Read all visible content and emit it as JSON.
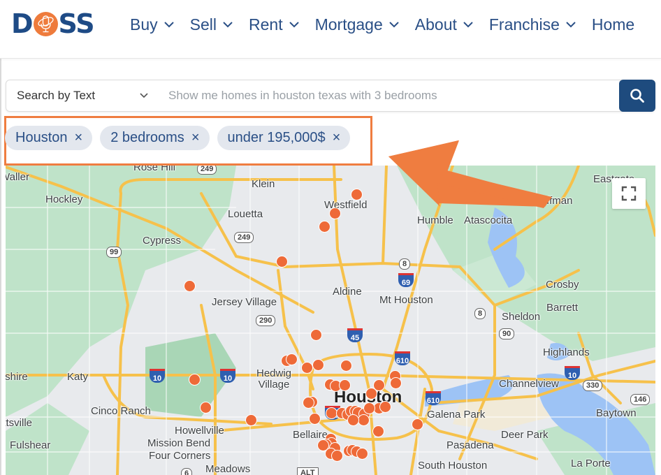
{
  "brand": {
    "logo_text_left": "D",
    "logo_text_right": "SS",
    "brand_color": "#1e4b86",
    "accent_color": "#ee7b3c"
  },
  "nav": {
    "items": [
      {
        "label": "Buy",
        "icon": "chevron-down-icon"
      },
      {
        "label": "Sell",
        "icon": "chevron-down-icon"
      },
      {
        "label": "Rent",
        "icon": "chevron-down-icon"
      },
      {
        "label": "Mortgage",
        "icon": "chevron-down-icon"
      },
      {
        "label": "About",
        "icon": "chevron-down-icon"
      },
      {
        "label": "Franchise",
        "icon": "chevron-down-icon"
      },
      {
        "label": "Home"
      }
    ]
  },
  "search": {
    "mode_label": "Search by Text",
    "placeholder": "Show me homes in houston texas with 3 bedrooms",
    "value": "",
    "button_icon": "search-icon"
  },
  "filters": {
    "chips": [
      {
        "label": "Houston",
        "remove": "×"
      },
      {
        "label": "2 bedrooms",
        "remove": "×"
      },
      {
        "label": "under 195,000$",
        "remove": "×"
      }
    ],
    "highlight_color": "#ef7d40"
  },
  "map": {
    "fullscreen_icon": "fullscreen-icon",
    "places": [
      {
        "name": "Waller"
      },
      {
        "name": "Rose Hill"
      },
      {
        "name": "Klein"
      },
      {
        "name": "Hockley"
      },
      {
        "name": "Westfield"
      },
      {
        "name": "Louetta"
      },
      {
        "name": "Humble"
      },
      {
        "name": "Atascocita"
      },
      {
        "name": "Huffman"
      },
      {
        "name": "Eastgate"
      },
      {
        "name": "Cypress"
      },
      {
        "name": "Crosby"
      },
      {
        "name": "Aldine"
      },
      {
        "name": "Jersey Village"
      },
      {
        "name": "Mt Houston"
      },
      {
        "name": "Barrett"
      },
      {
        "name": "Sheldon"
      },
      {
        "name": "Highlands"
      },
      {
        "name": "Katy"
      },
      {
        "name": "Hedwig Village"
      },
      {
        "name": "Channelview"
      },
      {
        "name": "Houston"
      },
      {
        "name": "Cinco Ranch"
      },
      {
        "name": "Galena Park"
      },
      {
        "name": "Baytown"
      },
      {
        "name": "Howellville"
      },
      {
        "name": "Bellaire"
      },
      {
        "name": "Deer Park"
      },
      {
        "name": "Mission Bend"
      },
      {
        "name": "Four Corners"
      },
      {
        "name": "Pasadena"
      },
      {
        "name": "Fulshear"
      },
      {
        "name": "Meadows"
      },
      {
        "name": "South Houston"
      },
      {
        "name": "La Porte"
      },
      {
        "name": "Brookshire"
      },
      {
        "name": "Brookshire"
      },
      {
        "name": "Pattsville"
      }
    ],
    "highways": [
      "249",
      "249",
      "99",
      "8",
      "69",
      "290",
      "45",
      "8",
      "90",
      "610",
      "10",
      "10",
      "610",
      "10",
      "330",
      "146",
      "610",
      "6",
      "ALT"
    ],
    "listing_pin_count": 49,
    "pin_color": "#ee6a38"
  }
}
